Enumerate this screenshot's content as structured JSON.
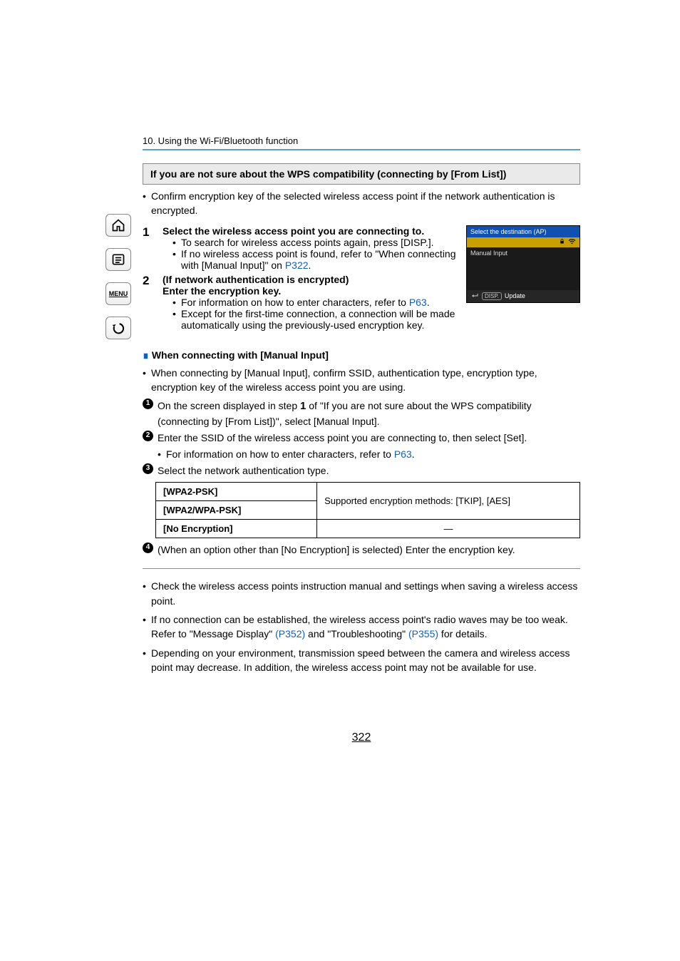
{
  "breadcrumb": "10. Using the Wi-Fi/Bluetooth function",
  "sidebar": {
    "home_label": "home",
    "list_label": "contents",
    "menu_label": "MENU",
    "back_label": "back"
  },
  "banner": "If you are not sure about the WPS compatibility (connecting by [From List])",
  "intro_bullet": "Confirm encryption key of the selected wireless access point if the network authentication is encrypted.",
  "figure": {
    "title": "Select the destination (AP)",
    "row1": "Manual Input",
    "footer_pill": "DISP.",
    "footer_text": "Update"
  },
  "steps": [
    {
      "num": "1",
      "title": "Select the wireless access point you are connecting to.",
      "subs": [
        {
          "text": "To search for wireless access points again, press [DISP.]."
        },
        {
          "text_a": "If no wireless access point is found, refer to \"When connecting with [Manual Input]\" on ",
          "link": "P322",
          "text_b": "."
        }
      ]
    },
    {
      "num": "2",
      "title_a": "(If network authentication is encrypted)",
      "title_b": "Enter the encryption key.",
      "subs": [
        {
          "text_a": "For information on how to enter characters, refer to ",
          "link": "P63",
          "text_b": "."
        },
        {
          "text": "Except for the first-time connection, a connection will be made automatically using the previously-used encryption key."
        }
      ]
    }
  ],
  "section2": {
    "title": "When connecting with [Manual Input]",
    "intro": "When connecting by [Manual Input], confirm SSID, authentication type, encryption type, encryption key of the wireless access point you are using.",
    "items": [
      {
        "n": "1",
        "text_a": "On the screen displayed in step ",
        "step": "1",
        "text_b": " of \"If you are not sure about the WPS compatibility (connecting by [From List])\", select [Manual Input]."
      },
      {
        "n": "2",
        "text": "Enter the SSID of the wireless access point you are connecting to, then select [Set].",
        "sub_a": "For information on how to enter characters, refer to ",
        "sub_link": "P63",
        "sub_b": "."
      },
      {
        "n": "3",
        "text": "Select the network authentication type."
      },
      {
        "n": "4",
        "text": "(When an option other than [No Encryption] is selected) Enter the encryption key."
      }
    ],
    "table": {
      "r1": "[WPA2-PSK]",
      "r2": "[WPA2/WPA-PSK]",
      "right1": "Supported encryption methods: [TKIP], [AES]",
      "r3": "[No Encryption]",
      "right3": "—"
    }
  },
  "notes": [
    "Check the wireless access points instruction manual and settings when saving a wireless access point.",
    "If no connection can be established, the wireless access point's radio waves may be too weak.",
    {
      "pre": "Refer to \"Message Display\" ",
      "l1": "(P352)",
      "mid": " and \"Troubleshooting\" ",
      "l2": "(P355)",
      "post": " for details."
    },
    "Depending on your environment, transmission speed between the camera and wireless access point may decrease. In addition, the wireless access point may not be available for use."
  ],
  "pagenum": "322"
}
